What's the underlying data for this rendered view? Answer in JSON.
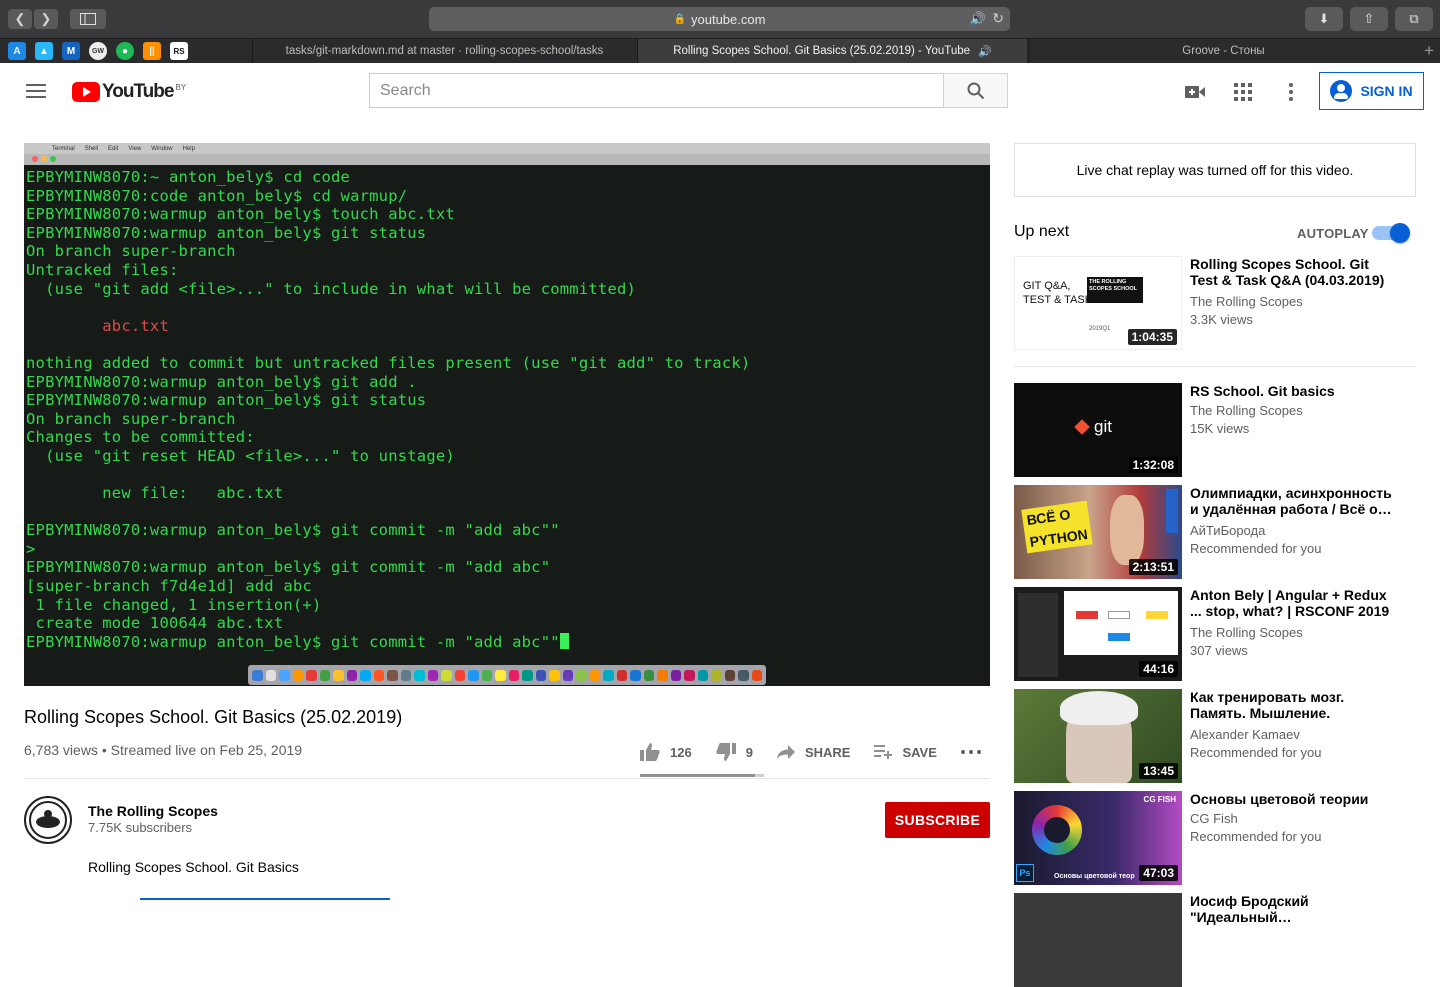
{
  "browser": {
    "url": "youtube.com",
    "tabs": [
      {
        "title": "tasks/git-markdown.md at master · rolling-scopes-school/tasks",
        "active": false
      },
      {
        "title": "Rolling Scopes School. Git Basics (25.02.2019) - YouTube",
        "active": true
      },
      {
        "title": "Groove - Стоны",
        "active": false
      }
    ],
    "favorites": [
      "app-store-icon",
      "maps-icon",
      "mail-icon",
      "gw-icon",
      "spotify-icon",
      "bars-icon",
      "rs-icon"
    ],
    "favorite_labels": {
      "gw": "GW",
      "rs": "RS"
    }
  },
  "header": {
    "logo_text": "YouTube",
    "country_code": "BY",
    "search_placeholder": "Search",
    "sign_in": "SIGN IN"
  },
  "video": {
    "terminal_lines": [
      "EPBYMINW8070:~ anton_bely$ cd code",
      "EPBYMINW8070:code anton_bely$ cd warmup/",
      "EPBYMINW8070:warmup anton_bely$ touch abc.txt",
      "EPBYMINW8070:warmup anton_bely$ git status",
      "On branch super-branch",
      "Untracked files:",
      "  (use \"git add <file>...\" to include in what will be committed)",
      "",
      "        abc.txt",
      "",
      "nothing added to commit but untracked files present (use \"git add\" to track)",
      "EPBYMINW8070:warmup anton_bely$ git add .",
      "EPBYMINW8070:warmup anton_bely$ git status",
      "On branch super-branch",
      "Changes to be committed:",
      "  (use \"git reset HEAD <file>...\" to unstage)",
      "",
      "        new file:   abc.txt",
      "",
      "EPBYMINW8070:warmup anton_bely$ git commit -m \"add abc\"\"",
      ">",
      "EPBYMINW8070:warmup anton_bely$ git commit -m \"add abc\"",
      "[super-branch f7d4e1d] add abc",
      " 1 file changed, 1 insertion(+)",
      " create mode 100644 abc.txt",
      "EPBYMINW8070:warmup anton_bely$ git commit -m \"add abc\"\""
    ],
    "red_line_index": 8,
    "title": "Rolling Scopes School. Git Basics (25.02.2019)",
    "meta": "6,783 views • Streamed live on Feb 25, 2019",
    "likes": "126",
    "dislikes": "9",
    "like_ratio": 0.93,
    "share_label": "SHARE",
    "save_label": "SAVE"
  },
  "channel": {
    "name": "The Rolling Scopes",
    "subscribers": "7.75K subscribers",
    "subscribe_label": "SUBSCRIBE",
    "description": "Rolling Scopes School. Git Basics"
  },
  "sidebar": {
    "chat_notice": "Live chat replay was turned off for this video.",
    "up_next": "Up next",
    "autoplay": "AUTOPLAY",
    "autoplay_on": true,
    "recs": [
      {
        "title": "Rolling Scopes School. Git Test & Task Q&A (04.03.2019)",
        "channel": "The Rolling Scopes",
        "info": "3.3K views",
        "duration": "1:04:35",
        "thumb_text": "GIT Q&A,\nTEST & TASK",
        "thumb_badge": "THE ROLLING SCOPES SCHOOL",
        "thumb_sub": "2019Q1"
      },
      {
        "title": "RS School. Git basics",
        "channel": "The Rolling Scopes",
        "info": "15K views",
        "duration": "1:32:08",
        "thumb_text": "git"
      },
      {
        "title": "Олимпиадки, асинхронность и удалённая работа / Всё о…",
        "channel": "АйТиБорода",
        "info": "Recommended for you",
        "duration": "2:13:51",
        "thumb_text": "ВСЁ О\nPYTHON"
      },
      {
        "title": "Anton Bely | Angular + Redux ... stop, what? | RSCONF 2019",
        "channel": "The Rolling Scopes",
        "info": "307 views",
        "duration": "44:16"
      },
      {
        "title": "Как тренировать мозг. Память. Мышление. Татьян…",
        "channel": "Alexander Kamaev",
        "info": "Recommended for you",
        "duration": "13:45"
      },
      {
        "title": "Основы цветовой теории",
        "channel": "CG Fish",
        "info": "Recommended for you",
        "duration": "47:03",
        "thumb_text": "Основы цветовой теор",
        "thumb_badge": "CG FISH"
      },
      {
        "title": "Иосиф Бродский \"Идеальный…",
        "channel": "",
        "info": "",
        "duration": ""
      }
    ]
  },
  "colors": {
    "accent": "#065fd4",
    "subscribe": "#cc0000",
    "terminal_green": "#34d84e"
  }
}
